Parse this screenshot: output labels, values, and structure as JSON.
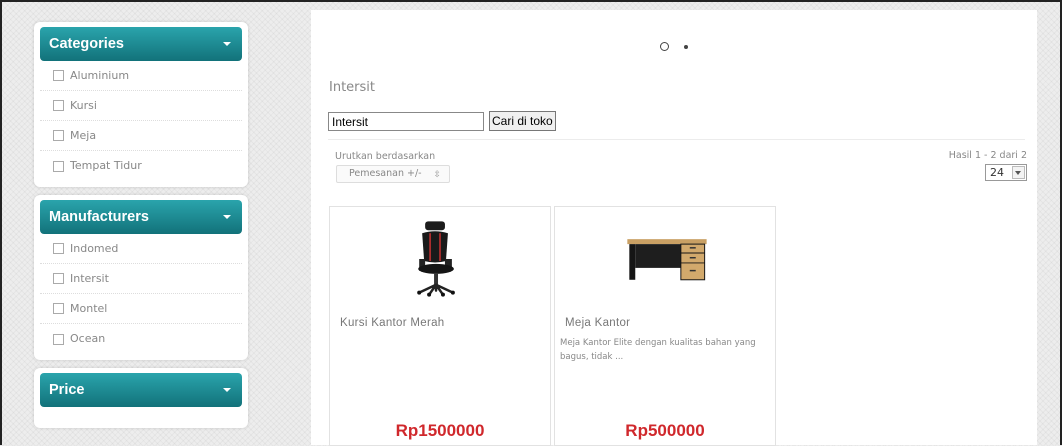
{
  "sidebar": {
    "categories": {
      "title": "Categories",
      "items": [
        "Aluminium",
        "Kursi",
        "Meja",
        "Tempat Tidur"
      ]
    },
    "manufacturers": {
      "title": "Manufacturers",
      "items": [
        "Indomed",
        "Intersit",
        "Montel",
        "Ocean"
      ]
    },
    "price": {
      "title": "Price"
    }
  },
  "main": {
    "heading": "Intersit",
    "search": {
      "value": "Intersit",
      "button_label": "Cari di toko"
    },
    "sort": {
      "label": "Urutkan berdasarkan",
      "selected": "Pemesanan +/-"
    },
    "results": {
      "text": "Hasil 1 - 2 dari 2",
      "per_page": "24"
    },
    "products": [
      {
        "name": "Kursi Kantor Merah",
        "description": "",
        "price": "Rp1500000",
        "image_icon": "office-chair-icon"
      },
      {
        "name": "Meja Kantor",
        "description": "Meja Kantor Elite dengan kualitas bahan yang bagus, tidak ...",
        "price": "Rp500000",
        "image_icon": "office-desk-icon"
      }
    ]
  },
  "colors": {
    "panel_header": "#1b8c94",
    "price": "#d0282c"
  }
}
